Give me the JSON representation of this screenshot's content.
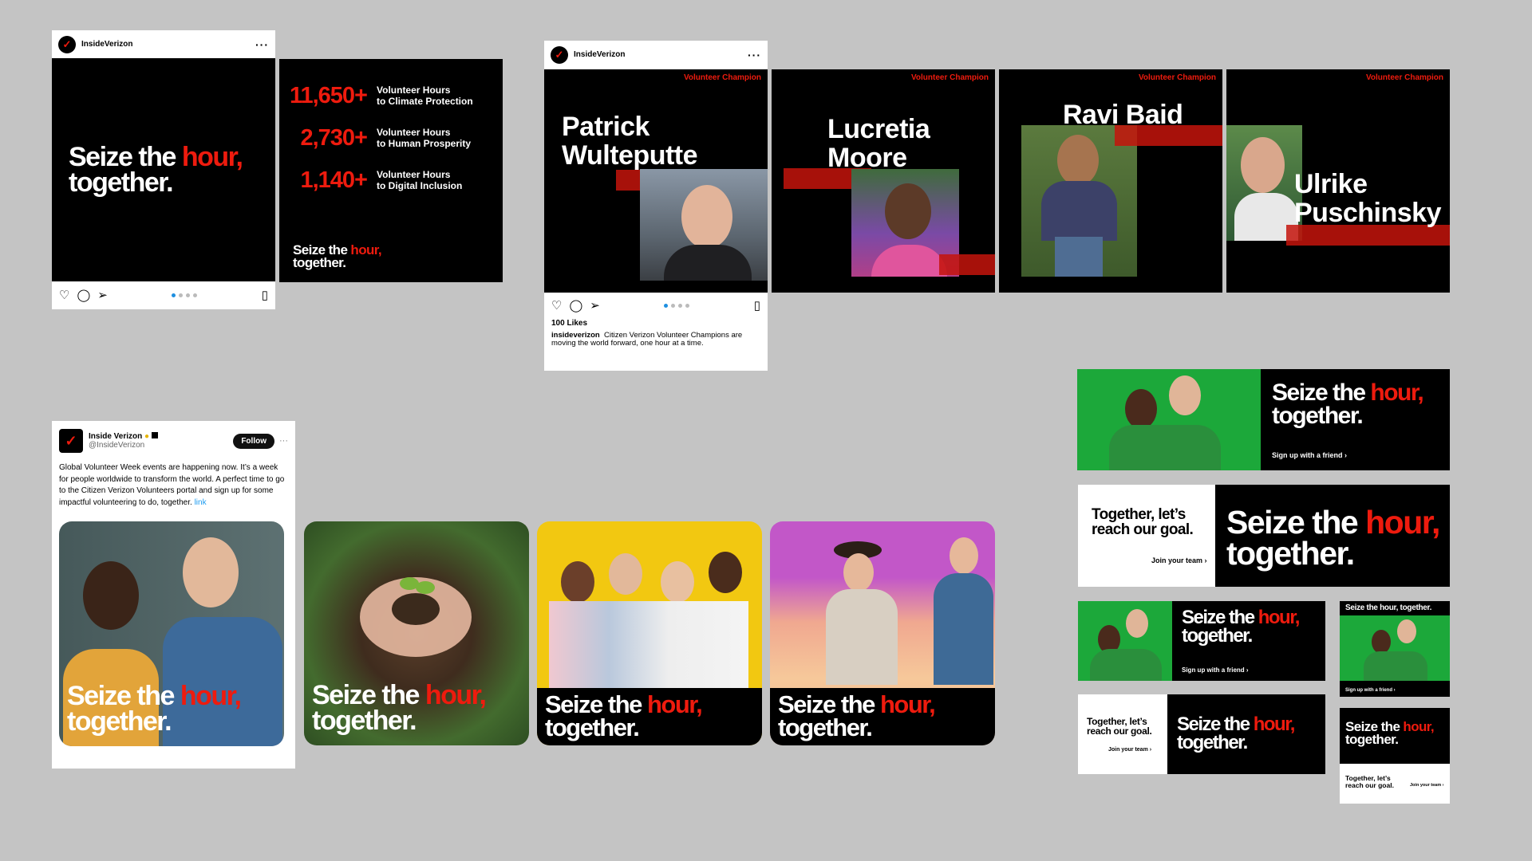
{
  "brand": {
    "accent": "#ee1b0e",
    "background": "#c4c4c4",
    "account": "InsideVerizon"
  },
  "ig_post_1": {
    "account": "InsideVerizon",
    "more_icon": "ellipsis-icon",
    "headline_a": "Seize the ",
    "headline_b": "hour,",
    "headline_c": "together.",
    "page": 1,
    "page_count": 4
  },
  "stats_panel": {
    "stats": [
      {
        "value": "11,650+",
        "line1": "Volunteer Hours",
        "line2": "to Climate Protection"
      },
      {
        "value": "2,730+",
        "line1": "Volunteer Hours",
        "line2": "to Human Prosperity"
      },
      {
        "value": "1,140+",
        "line1": "Volunteer Hours",
        "line2": "to Digital Inclusion"
      }
    ],
    "tagline_a": "Seize the ",
    "tagline_b": "hour,",
    "tagline_c": "together."
  },
  "ig_post_2": {
    "account": "InsideVerizon",
    "likes": "100 Likes",
    "caption_user": "insideverizon",
    "caption_text": "Citizen Verizon Volunteer Champions are moving the world forward, one hour at a time.",
    "page": 1,
    "page_count": 4
  },
  "champions": [
    {
      "tag": "Volunteer Champion",
      "first": "Patrick",
      "last": "Wulteputte"
    },
    {
      "tag": "Volunteer Champion",
      "first": "Lucretia",
      "last": "Moore"
    },
    {
      "tag": "Volunteer Champion",
      "first": "Ravi Baid",
      "last": ""
    },
    {
      "tag": "Volunteer Champion",
      "first": "Ulrike",
      "last": "Puschinsky"
    }
  ],
  "tweet": {
    "name": "Inside Verizon",
    "handle": "@InsideVerizon",
    "follow": "Follow",
    "more": "···",
    "text": "Global Volunteer Week events are happening now. It’s a week for people worldwide to transform the world. A perfect time to go to the Citizen Verizon Volunteers portal and sign up for some impactful volunteering to do, together.",
    "link": "link"
  },
  "social_cards": [
    {
      "a": "Seize the ",
      "b": "hour,",
      "c": "together."
    },
    {
      "a": "Seize the ",
      "b": "hour,",
      "c": "together."
    },
    {
      "a": "Seize the ",
      "b": "hour,",
      "c": "together."
    },
    {
      "a": "Seize the ",
      "b": "hour,",
      "c": "together."
    }
  ],
  "banners": {
    "headline_a": "Seize the ",
    "headline_b": "hour,",
    "headline_c": "together.",
    "headline_inline": "Seize the hour, together.",
    "cta_friend": "Sign up with a friend",
    "goal_line": "Together, let’s reach our goal.",
    "cta_team": "Join your team",
    "chevron": "›"
  }
}
